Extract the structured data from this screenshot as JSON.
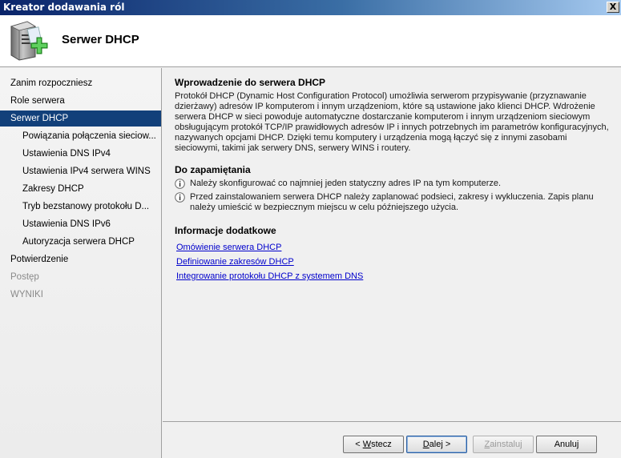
{
  "window": {
    "title": "Kreator dodawania ról",
    "close_glyph": "X"
  },
  "header": {
    "title": "Serwer DHCP",
    "icon": "server-add-icon"
  },
  "sidebar": {
    "items": [
      {
        "label": "Zanim rozpoczniesz",
        "level": 1,
        "state": "normal"
      },
      {
        "label": "Role serwera",
        "level": 1,
        "state": "normal"
      },
      {
        "label": "Serwer DHCP",
        "level": 1,
        "state": "active"
      },
      {
        "label": "Powiązania połączenia sieciow...",
        "level": 2,
        "state": "normal"
      },
      {
        "label": "Ustawienia DNS IPv4",
        "level": 2,
        "state": "normal"
      },
      {
        "label": "Ustawienia IPv4 serwera WINS",
        "level": 2,
        "state": "normal"
      },
      {
        "label": "Zakresy DHCP",
        "level": 2,
        "state": "normal"
      },
      {
        "label": "Tryb bezstanowy protokołu D...",
        "level": 2,
        "state": "normal"
      },
      {
        "label": "Ustawienia DNS IPv6",
        "level": 2,
        "state": "normal"
      },
      {
        "label": "Autoryzacja serwera DHCP",
        "level": 2,
        "state": "normal"
      },
      {
        "label": "Potwierdzenie",
        "level": 1,
        "state": "normal"
      },
      {
        "label": "Postęp",
        "level": 1,
        "state": "disabled"
      },
      {
        "label": "WYNIKI",
        "level": 1,
        "state": "disabled"
      }
    ]
  },
  "main": {
    "intro_title": "Wprowadzenie do serwera DHCP",
    "intro_text": "Protokół DHCP (Dynamic Host Configuration Protocol) umożliwia serwerom przypisywanie (przyznawanie dzierżawy) adresów IP komputerom i innym urządzeniom, które są ustawione jako klienci DHCP. Wdrożenie serwera DHCP w sieci powoduje automatyczne dostarczanie komputerom i innym urządzeniom sieciowym obsługującym protokół TCP/IP prawidłowych adresów IP i innych potrzebnych im parametrów konfiguracyjnych, nazywanych opcjami DHCP. Dzięki temu komputery i urządzenia mogą łączyć się z innymi zasobami sieciowymi, takimi jak serwery DNS, serwery WINS i routery.",
    "remember_title": "Do zapamiętania",
    "notes": [
      "Należy skonfigurować co najmniej jeden statyczny adres IP na tym komputerze.",
      "Przed zainstalowaniem serwera DHCP należy zaplanować podsieci, zakresy i wykluczenia. Zapis planu należy umieścić w bezpiecznym miejscu w celu późniejszego użycia."
    ],
    "more_title": "Informacje dodatkowe",
    "links": [
      "Omówienie serwera DHCP",
      "Definiowanie zakresów DHCP",
      "Integrowanie protokołu DHCP z systemem DNS"
    ]
  },
  "buttons": {
    "back_prefix": "< ",
    "back_hotkey": "W",
    "back_rest": "stecz",
    "next_hotkey": "D",
    "next_rest": "alej >",
    "install_hotkey": "Z",
    "install_rest": "ainstaluj",
    "cancel": "Anuluj"
  }
}
